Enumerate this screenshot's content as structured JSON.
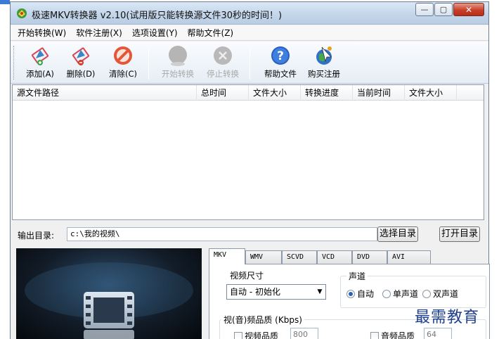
{
  "window": {
    "title": "极速MKV转换器 v2.10(试用版只能转换源文件30秒的时间！)",
    "minimize": "—",
    "maximize": "▢",
    "close": "✕"
  },
  "menu": [
    "开始转换(W)",
    "软件注册(X)",
    "选项设置(Y)",
    "帮助文件(Z)"
  ],
  "toolbar": {
    "add": "添加(A)",
    "delete": "删除(D)",
    "clear": "清除(C)",
    "start": "开始转换",
    "stop": "停止转换",
    "help": "帮助文件",
    "buy": "购买注册"
  },
  "filelist": {
    "columns": [
      "源文件路径",
      "总时间",
      "文件大小",
      "转换进度",
      "当前时间",
      "文件大小"
    ]
  },
  "output": {
    "label": "输出目录:",
    "path": "c:\\我的视频\\",
    "choose": "选择目录",
    "open": "打开目录"
  },
  "tabs": [
    "MKV",
    "WMV",
    "SCVD",
    "VCD",
    "DVD",
    "AVI"
  ],
  "settings": {
    "video_size_title": "视频尺寸",
    "video_size_value": "自动 - 初始化",
    "channel_title": "声道",
    "channel_auto": "自动",
    "channel_mono": "单声道",
    "channel_stereo": "双声道",
    "quality_title": "视(音)频品质 (Kbps)",
    "video_quality_label": "视频品质",
    "video_quality_value": "800",
    "audio_quality_label": "音频品质",
    "audio_quality_value": "64"
  },
  "watermark": "最需教育",
  "colors": {
    "accent": "#2b5fb8",
    "close": "#c8402a"
  }
}
